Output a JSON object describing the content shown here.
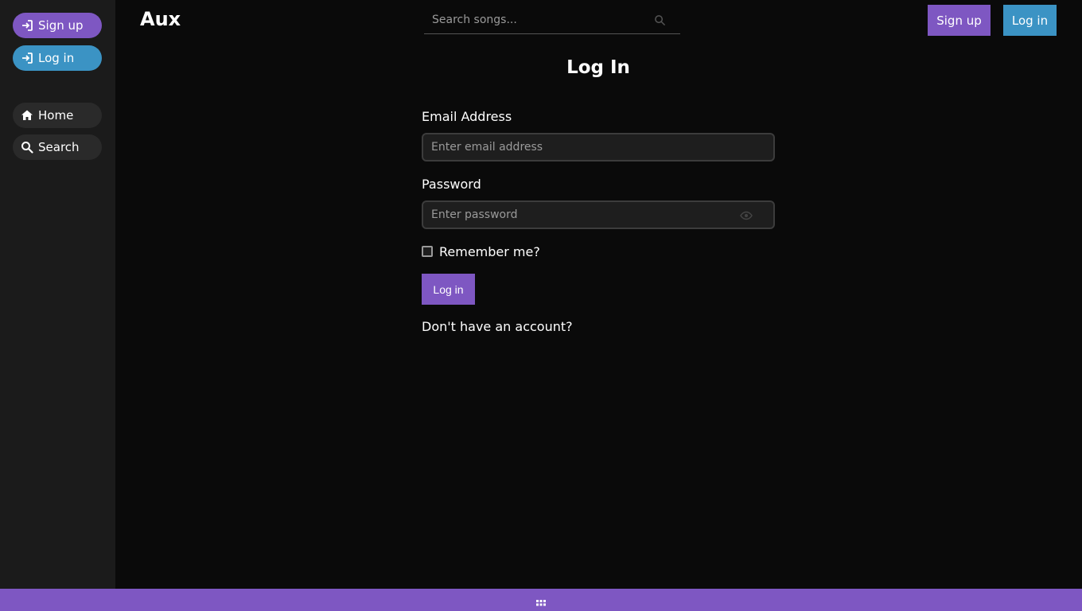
{
  "sidebar": {
    "signup_label": "Sign up",
    "login_label": "Log in",
    "home_label": "Home",
    "search_label": "Search"
  },
  "header": {
    "brand": "Aux",
    "search_placeholder": "Search songs...",
    "signup_label": "Sign up",
    "login_label": "Log in"
  },
  "form": {
    "title": "Log In",
    "email_label": "Email Address",
    "email_placeholder": "Enter email address",
    "password_label": "Password",
    "password_placeholder": "Enter password",
    "remember_label": "Remember me?",
    "submit_label": "Log in",
    "no_account_text": "Don't have an account?"
  },
  "icons": {
    "signup": "sign-in-icon",
    "login": "sign-in-icon",
    "home": "home-icon",
    "search": "search-icon",
    "eye": "eye-icon",
    "grid": "grid-icon"
  },
  "colors": {
    "accent_purple": "#7e57c2",
    "accent_blue": "#3b93c4",
    "background": "#0a0a0a",
    "sidebar": "#1b1b1b"
  }
}
